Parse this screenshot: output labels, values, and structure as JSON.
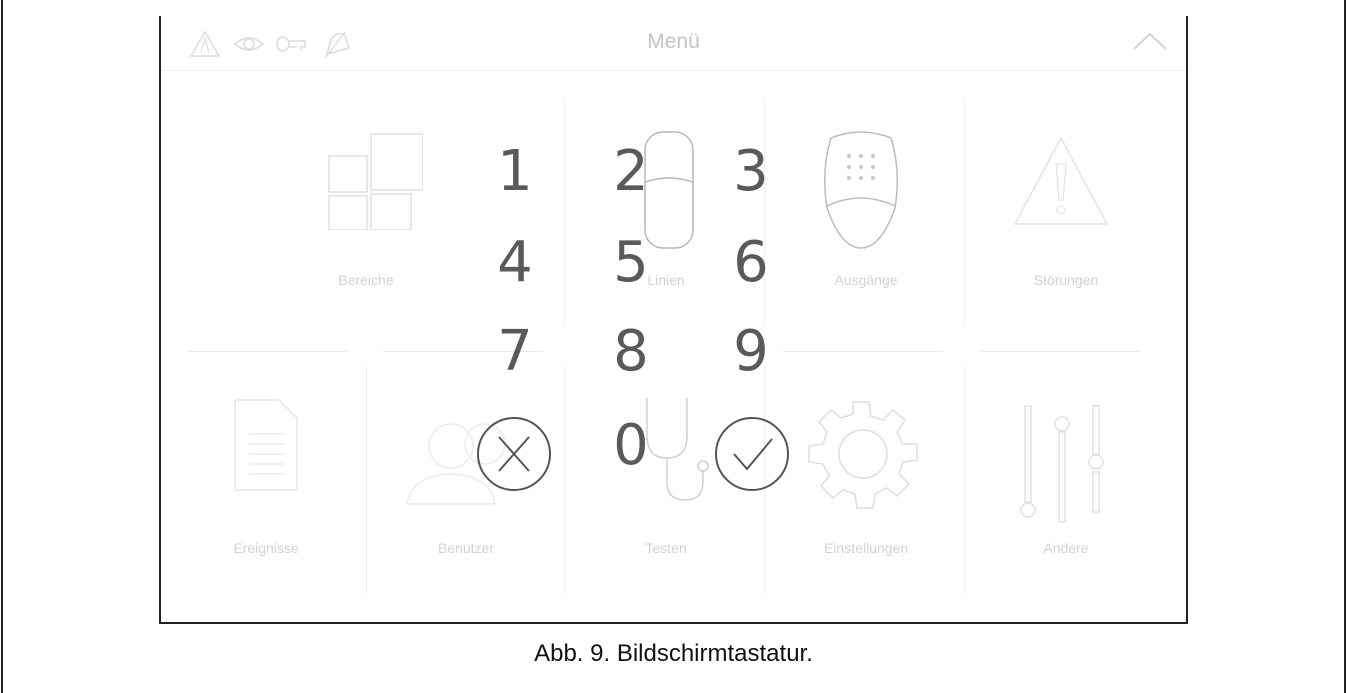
{
  "screen": {
    "menu_title": "Menü",
    "status_icons": [
      "warning-icon",
      "eye-icon",
      "key-icon",
      "bell-icon"
    ],
    "collapse_icon": "chevron-up-icon",
    "tiles": [
      {
        "label": "Bereiche",
        "icon": "partitions-icon"
      },
      {
        "label": "Linien",
        "icon": "detector-icon"
      },
      {
        "label": "Ausgänge",
        "icon": "siren-icon"
      },
      {
        "label": "Störungen",
        "icon": "troubles-icon"
      },
      {
        "label": "Ereignisse",
        "icon": "document-icon"
      },
      {
        "label": "Benutzer",
        "icon": "users-icon"
      },
      {
        "label": "Testen",
        "icon": "stethoscope-icon"
      },
      {
        "label": "Einstellungen",
        "icon": "gear-icon"
      },
      {
        "label": "Andere",
        "icon": "sliders-icon"
      }
    ]
  },
  "keypad": {
    "keys": [
      "1",
      "2",
      "3",
      "4",
      "5",
      "6",
      "7",
      "8",
      "9",
      "0"
    ],
    "cancel_icon": "cancel-icon",
    "confirm_icon": "confirm-icon"
  },
  "caption": "Abb. 9. Bildschirmtastatur.",
  "colors": {
    "frame": "#222222",
    "digits": "#5a5a5a",
    "faded": "#d8d8d8"
  }
}
